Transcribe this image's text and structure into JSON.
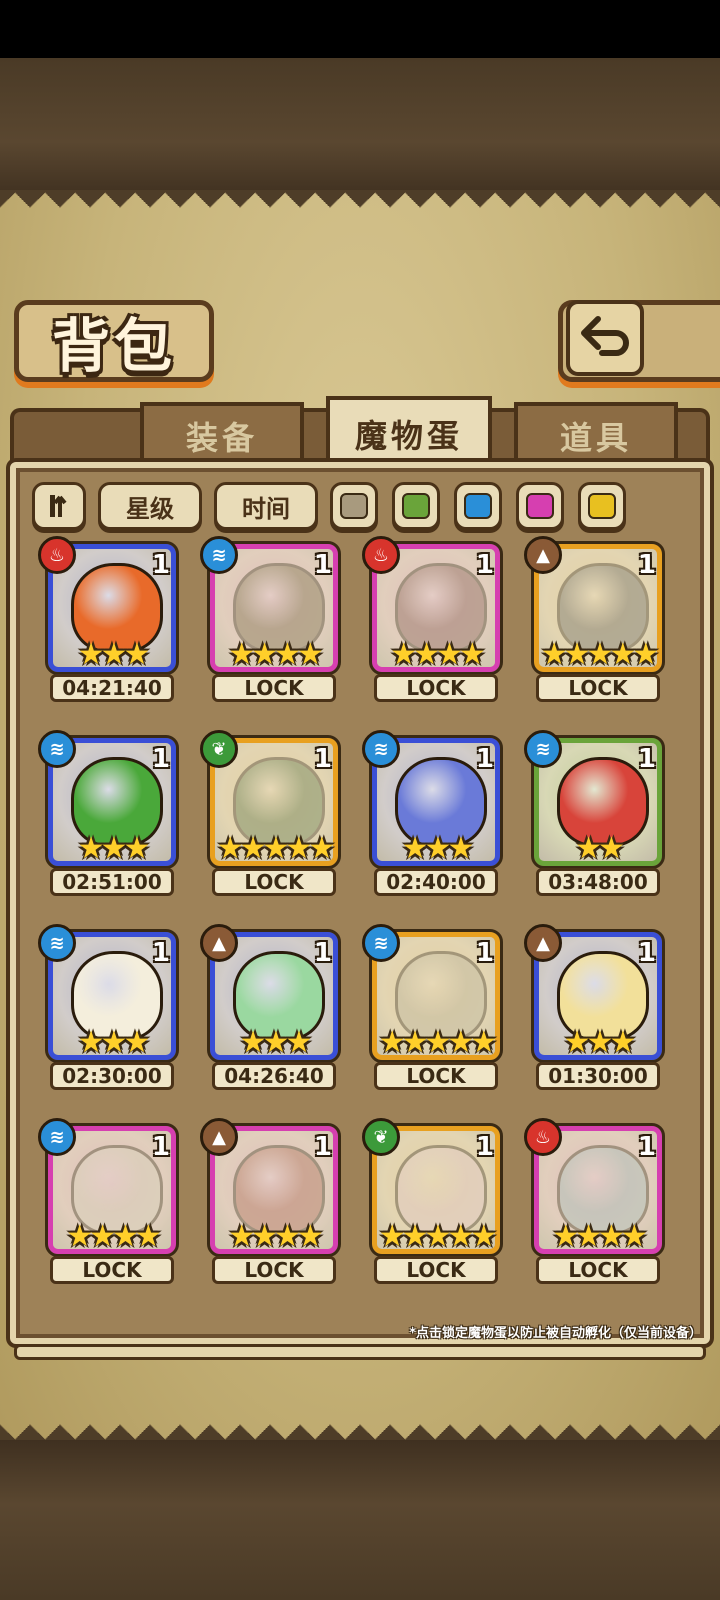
{
  "title": "背包",
  "tabs": [
    {
      "label": "装备",
      "active": false
    },
    {
      "label": "魔物蛋",
      "active": true
    },
    {
      "label": "道具",
      "active": false
    }
  ],
  "filters": {
    "sort_icon": "sort-toggle-icon",
    "star_label": "星级",
    "time_label": "时间",
    "color_swatches": [
      "#a89a7e",
      "#6aa43a",
      "#2a8fd8",
      "#d63fb0",
      "#e8c020"
    ]
  },
  "element_colors": {
    "fire": "#d8342c",
    "water": "#2a8fd8",
    "earth": "#8a5a36",
    "leaf": "#3c9a3a"
  },
  "rarity_colors": {
    "blue": "#3a4fd6",
    "pink": "#d63fb0",
    "gold": "#e8a020",
    "green": "#6aa43a"
  },
  "eggs": [
    {
      "element": "fire",
      "element_icon": "flame-icon",
      "rarity": "blue",
      "count": "1",
      "stars": "★★★",
      "label": "04:21:40",
      "locked": false,
      "art": "#e86a2a"
    },
    {
      "element": "water",
      "element_icon": "wave-icon",
      "rarity": "pink",
      "count": "1",
      "stars": "★★★★",
      "label": "LOCK",
      "locked": true,
      "art": "#6a5a3a"
    },
    {
      "element": "fire",
      "element_icon": "flame-icon",
      "rarity": "pink",
      "count": "1",
      "stars": "★★★★",
      "label": "LOCK",
      "locked": true,
      "art": "#7a4a4a"
    },
    {
      "element": "earth",
      "element_icon": "mountain-icon",
      "rarity": "gold",
      "count": "1",
      "stars": "★★★★★",
      "label": "LOCK",
      "locked": true,
      "art": "#5a5a5a"
    },
    {
      "element": "water",
      "element_icon": "wave-icon",
      "rarity": "blue",
      "count": "1",
      "stars": "★★★",
      "label": "02:51:00",
      "locked": false,
      "art": "#4aa83a"
    },
    {
      "element": "leaf",
      "element_icon": "leaf-icon",
      "rarity": "gold",
      "count": "1",
      "stars": "★★★★★",
      "label": "LOCK",
      "locked": true,
      "art": "#4a6a3a"
    },
    {
      "element": "water",
      "element_icon": "wave-icon",
      "rarity": "blue",
      "count": "1",
      "stars": "★★★",
      "label": "02:40:00",
      "locked": false,
      "art": "#6a7ad8"
    },
    {
      "element": "water",
      "element_icon": "wave-icon",
      "rarity": "green",
      "count": "1",
      "stars": "★★",
      "label": "03:48:00",
      "locked": false,
      "art": "#d8443a"
    },
    {
      "element": "water",
      "element_icon": "wave-icon",
      "rarity": "blue",
      "count": "1",
      "stars": "★★★",
      "label": "02:30:00",
      "locked": false,
      "art": "#f4eedc"
    },
    {
      "element": "earth",
      "element_icon": "mountain-icon",
      "rarity": "blue",
      "count": "1",
      "stars": "★★★",
      "label": "04:26:40",
      "locked": false,
      "art": "#9ad8a0"
    },
    {
      "element": "water",
      "element_icon": "wave-icon",
      "rarity": "gold",
      "count": "1",
      "stars": "★★★★★",
      "label": "LOCK",
      "locked": true,
      "art": "#b8b098"
    },
    {
      "element": "earth",
      "element_icon": "mountain-icon",
      "rarity": "blue",
      "count": "1",
      "stars": "★★★",
      "label": "01:30:00",
      "locked": false,
      "art": "#f2e09a"
    },
    {
      "element": "water",
      "element_icon": "wave-icon",
      "rarity": "pink",
      "count": "1",
      "stars": "★★★★",
      "label": "LOCK",
      "locked": true,
      "art": "#d8d0c0"
    },
    {
      "element": "earth",
      "element_icon": "mountain-icon",
      "rarity": "pink",
      "count": "1",
      "stars": "★★★★",
      "label": "LOCK",
      "locked": true,
      "art": "#a85a4a"
    },
    {
      "element": "leaf",
      "element_icon": "leaf-icon",
      "rarity": "gold",
      "count": "1",
      "stars": "★★★★★",
      "label": "LOCK",
      "locked": true,
      "art": "#e8c8d0"
    },
    {
      "element": "fire",
      "element_icon": "flame-icon",
      "rarity": "pink",
      "count": "1",
      "stars": "★★★★",
      "label": "LOCK",
      "locked": true,
      "art": "#9ab8c0"
    }
  ],
  "footnote": "*点击锁定魔物蛋以防止被自动孵化（仅当前设备）"
}
